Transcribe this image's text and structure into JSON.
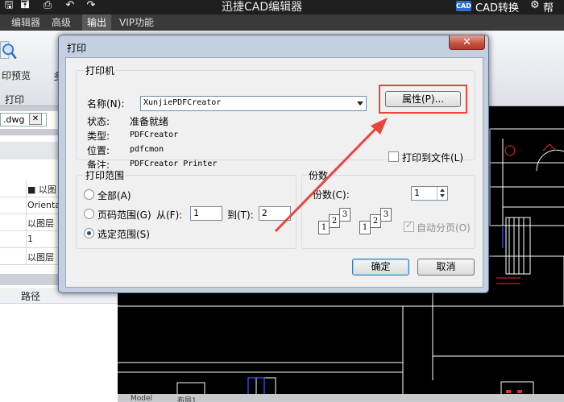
{
  "app": {
    "title": "迅捷CAD编辑器",
    "cad_badge": "CAD",
    "cad_convert": "CAD转换",
    "user_partial": "帮"
  },
  "menubar": {
    "tabs": [
      {
        "label": "编辑器",
        "active": false
      },
      {
        "label": "高级",
        "active": false
      },
      {
        "label": "输出",
        "active": true
      },
      {
        "label": "VIP功能",
        "active": false
      }
    ]
  },
  "ribbon": {
    "preview_label": "印预览",
    "print_group_label": "打印",
    "partial_label": "多"
  },
  "left_panel": {
    "file_tab": ".dwg",
    "file_tab_close": "✕",
    "properties": [
      "■ 以图",
      "Orientati",
      "以图层",
      "1",
      "以图层"
    ],
    "path_header": "路径"
  },
  "model_tabs": [
    "Model",
    "布局1"
  ],
  "dialog": {
    "title": "打印",
    "close_label": "✕",
    "printer_group": {
      "title": "打印机",
      "name_label": "名称(N):",
      "name_value": "XunjiePDFCreator",
      "properties_button": "属性(P)...",
      "status_label": "状态:",
      "status_value": "准备就绪",
      "type_label": "类型:",
      "type_value": "PDFCreator",
      "location_label": "位置:",
      "location_value": "pdfcmon",
      "comment_label": "备注:",
      "comment_value": "PDFCreator Printer",
      "print_to_file_label": "打印到文件(L)",
      "print_to_file_checked": false
    },
    "range_group": {
      "title": "打印范围",
      "all_label": "全部(A)",
      "pages_label": "页码范围(G)",
      "from_label": "从(F):",
      "from_value": "1",
      "to_label": "到(T):",
      "to_value": "2",
      "selection_label": "选定范围(S)",
      "selected": "selection"
    },
    "copies_group": {
      "title": "份数",
      "copies_label": "份数(C):",
      "copies_value": "1",
      "collate_label": "自动分页(O)",
      "collate_checked": true,
      "collate_pages": [
        "1",
        "2",
        "3"
      ]
    },
    "ok_button": "确定",
    "cancel_button": "取消"
  },
  "annotation": {
    "highlight_color": "#e8453c"
  }
}
